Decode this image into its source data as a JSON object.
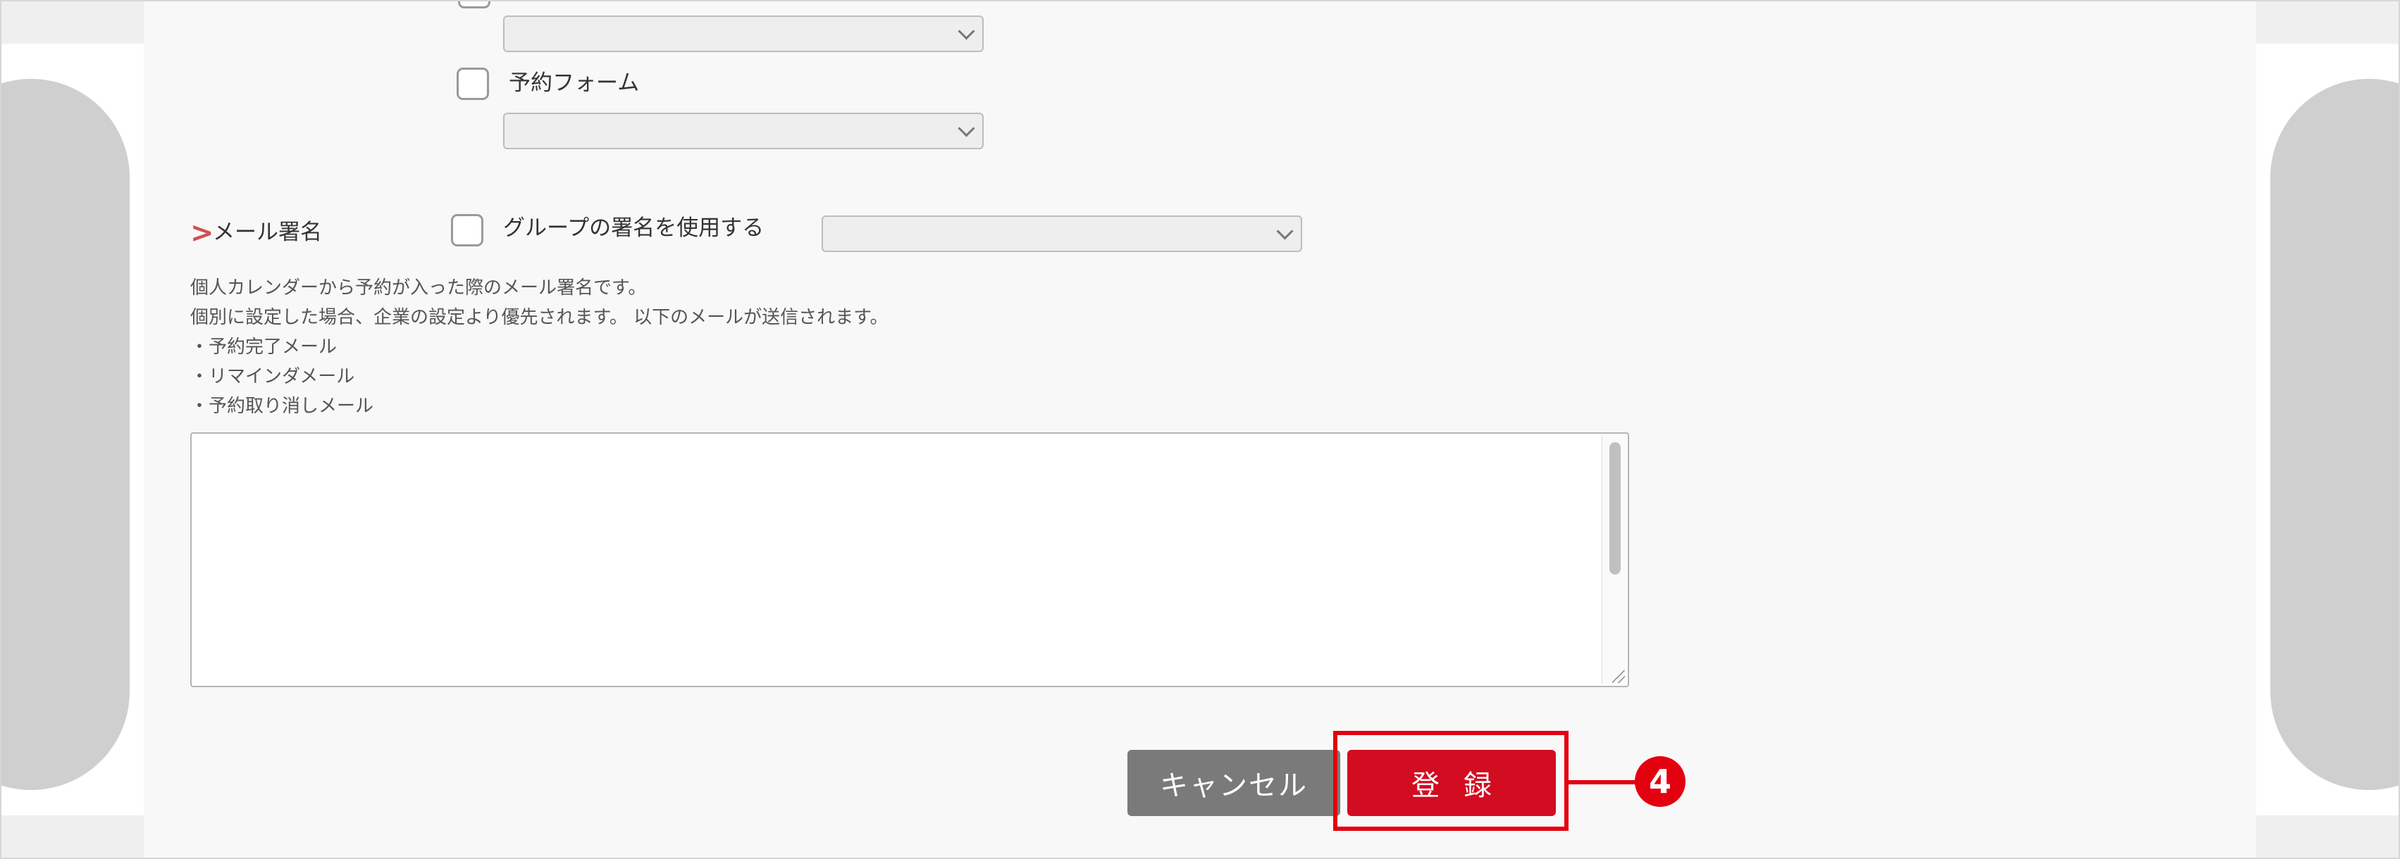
{
  "form": {
    "reservation_form": {
      "checkbox_label": "予約フォーム"
    },
    "mail_signature": {
      "marker": ">",
      "label": "メール署名",
      "use_group_signature_label": "グループの署名を使用する",
      "description_lines": [
        "個人カレンダーから予約が入った際のメール署名です。",
        "個別に設定した場合、企業の設定より優先されます。 以下のメールが送信されます。",
        "・予約完了メール",
        "・リマインダメール",
        "・予約取り消しメール"
      ],
      "textarea_value": ""
    }
  },
  "buttons": {
    "cancel_label": "キャンセル",
    "register_label": "登録"
  },
  "annotation": {
    "step_number": "4"
  },
  "colors": {
    "register_button": "#d20c21",
    "cancel_button": "#7a7a7a",
    "highlight": "#e3000f",
    "section_marker": "#d05050"
  }
}
